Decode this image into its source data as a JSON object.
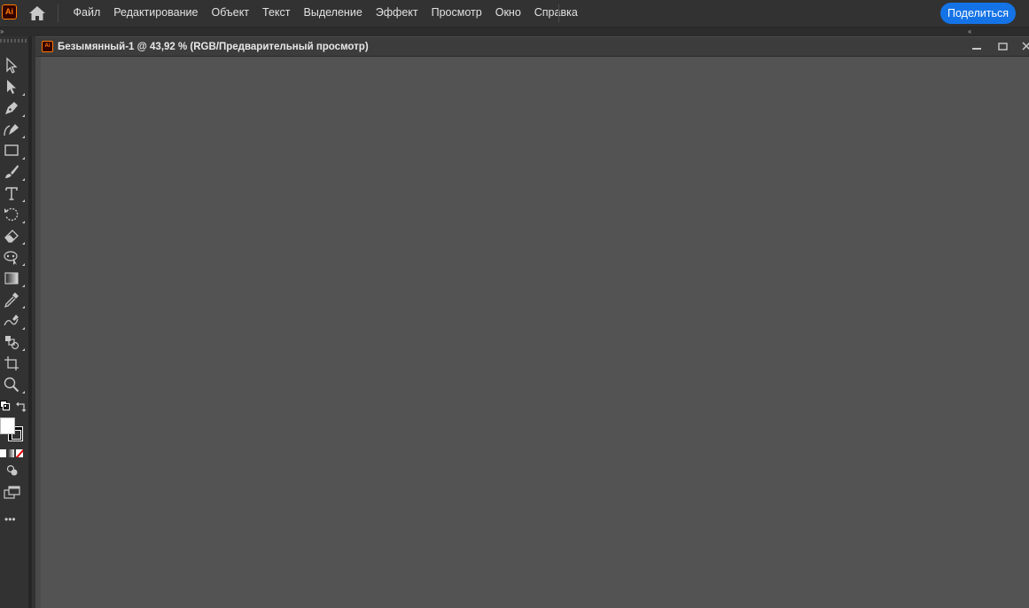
{
  "app": {
    "logo_text": "Ai",
    "accent_color": "#ff7c00",
    "share_button_color": "#1473e6"
  },
  "menu": {
    "items": [
      "Файл",
      "Редактирование",
      "Объект",
      "Текст",
      "Выделение",
      "Эффект",
      "Просмотр",
      "Окно",
      "Справка"
    ]
  },
  "share": {
    "label": "Поделиться"
  },
  "document": {
    "icon_text": "Ai",
    "title": "Безымянный-1 @ 43,92 % (RGB/Предварительный просмотр)"
  },
  "panel_toggles": {
    "left": "››",
    "right": "‹‹"
  },
  "toolbar": {
    "tools": [
      {
        "name": "selection-tool",
        "icon": "selection-arrow-icon"
      },
      {
        "name": "direct-selection-tool",
        "icon": "direct-selection-arrow-icon"
      },
      {
        "name": "pen-tool",
        "icon": "pen-icon"
      },
      {
        "name": "curvature-tool",
        "icon": "curvature-pen-icon"
      },
      {
        "name": "rectangle-tool",
        "icon": "rectangle-icon"
      },
      {
        "name": "paintbrush-tool",
        "icon": "paintbrush-icon"
      },
      {
        "name": "type-tool",
        "icon": "type-icon"
      },
      {
        "name": "rotate-tool",
        "icon": "rotate-icon"
      },
      {
        "name": "eraser-tool",
        "icon": "eraser-icon"
      },
      {
        "name": "puppet-warp-tool",
        "icon": "puppet-warp-icon"
      },
      {
        "name": "gradient-tool",
        "icon": "gradient-icon"
      },
      {
        "name": "eyedropper-tool",
        "icon": "eyedropper-icon"
      },
      {
        "name": "blend-tool",
        "icon": "blend-icon"
      },
      {
        "name": "symbol-sprayer-tool",
        "icon": "symbol-sprayer-icon"
      },
      {
        "name": "artboard-tool",
        "icon": "artboard-icon"
      },
      {
        "name": "zoom-tool",
        "icon": "zoom-icon"
      }
    ],
    "more_label": "•••"
  }
}
